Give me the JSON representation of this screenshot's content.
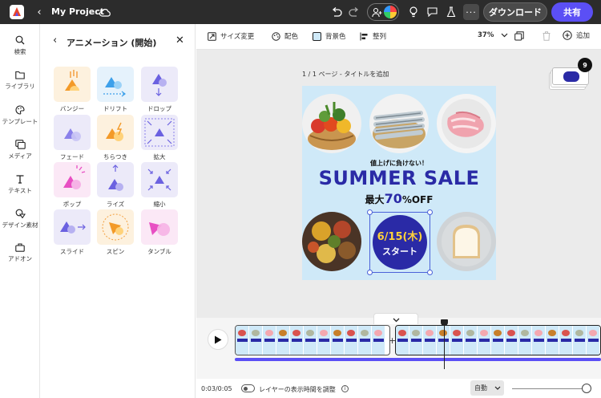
{
  "topbar": {
    "project_title": "My Project",
    "download_label": "ダウンロード",
    "share_label": "共有",
    "colors": {
      "bg": "#2c2c2c",
      "share": "#5b4ff5",
      "download": "#4a4a4a"
    }
  },
  "rail": {
    "items": [
      {
        "label": "検索",
        "icon": "search-icon"
      },
      {
        "label": "ライブラリ",
        "icon": "folder-icon"
      },
      {
        "label": "テンプレート",
        "icon": "palette-icon"
      },
      {
        "label": "メディア",
        "icon": "media-icon"
      },
      {
        "label": "テキスト",
        "icon": "text-icon"
      },
      {
        "label": "デザイン素材",
        "icon": "shapes-icon"
      },
      {
        "label": "アドオン",
        "icon": "briefcase-icon"
      }
    ]
  },
  "panel": {
    "title": "アニメーション (開始)",
    "animations": [
      {
        "label": "バンジー"
      },
      {
        "label": "ドリフト"
      },
      {
        "label": "ドロップ"
      },
      {
        "label": "フェード"
      },
      {
        "label": "ちらつき"
      },
      {
        "label": "拡大"
      },
      {
        "label": "ポップ"
      },
      {
        "label": "ライズ"
      },
      {
        "label": "縮小"
      },
      {
        "label": "スライド"
      },
      {
        "label": "スピン"
      },
      {
        "label": "タンブル"
      }
    ]
  },
  "toolbar": {
    "resize_label": "サイズ変更",
    "color_label": "配色",
    "bg_color_label": "背景色",
    "align_label": "整列",
    "zoom": "37%",
    "add_label": "追加"
  },
  "canvas": {
    "page_info": "1 / 1 ページ - タイトルを追加",
    "page_count_badge": "9",
    "design": {
      "tagline": "値上げに負けない！",
      "headline": "SUMMER SALE",
      "discount_prefix": "最大",
      "discount_value": "70",
      "discount_suffix": "%OFF",
      "date_text": "6/15(木)",
      "start_text": "スタート"
    }
  },
  "timeline": {
    "time_display": "0:03/0:05",
    "layer_toggle_label": "レイヤーの表示時間を調整",
    "speed_value": "自動",
    "thumbs": {
      "headline": "SUMMER SALE"
    }
  }
}
